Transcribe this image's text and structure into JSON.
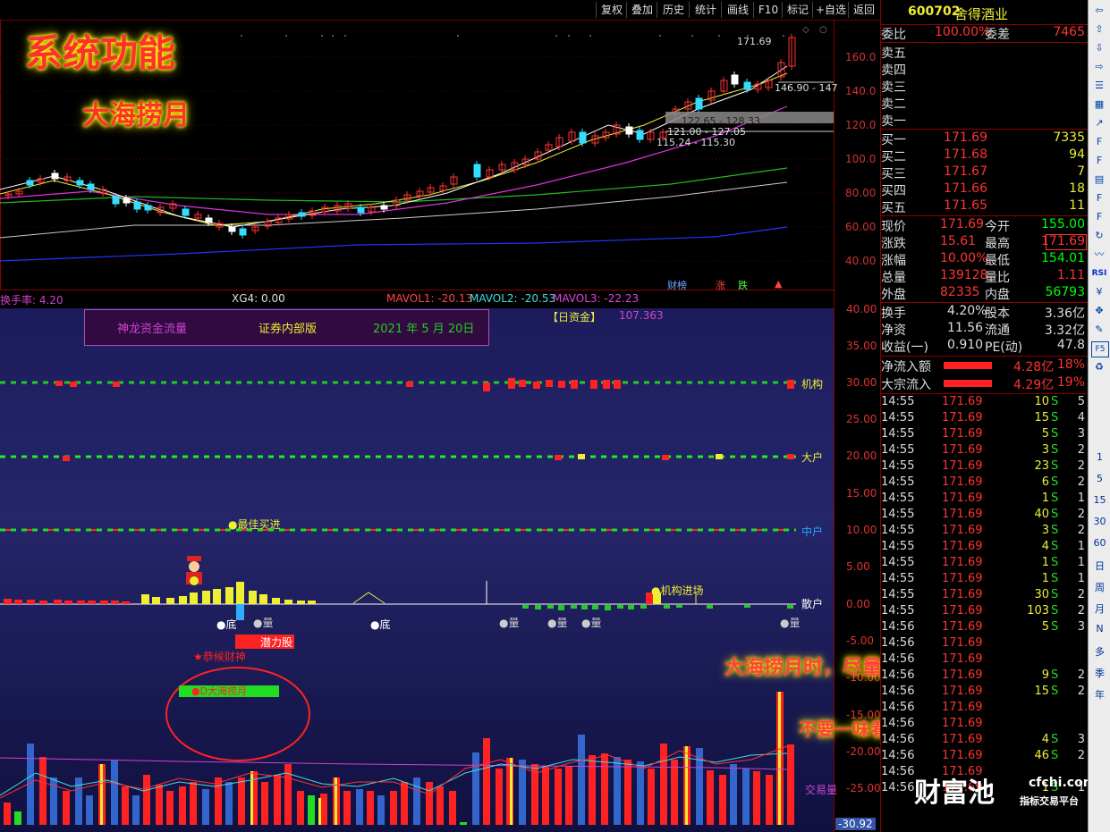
{
  "toolbar": {
    "buttons": [
      "复权",
      "叠加",
      "历史",
      "统计",
      "画线",
      "F10",
      "标记",
      "+自选",
      "返回"
    ]
  },
  "overlay": {
    "title": "系统功能",
    "subtitle": "大海捞月",
    "note1": "大海捞月时，尽量分析公司基本面",
    "note2": "不要一味看一个指标参数",
    "watermark_brand": "财富池",
    "watermark_url": "cfchi.com",
    "watermark_tag": "指标交易平台"
  },
  "kline": {
    "price_axis": [
      "160.0",
      "140.0",
      "120.0",
      "100.0",
      "80.00",
      "60.00",
      "40.00"
    ],
    "high_label": "171.69",
    "annotations": [
      "146.90 - 147",
      "122.65 - 128.33",
      "121.00 - 127.05",
      "115.24 - 115.30"
    ],
    "bottom_tags": [
      "财榜",
      "涨",
      "跌"
    ]
  },
  "indicator_bar": {
    "turnover": "换手率: 4.20",
    "xg4": "XG4: 0.00",
    "mavol1": "MAVOL1: -20.13",
    "mavol2": "MAVOL2: -20.53",
    "mavol3": "MAVOL3: -22.23"
  },
  "fund_panel": {
    "header_left": "神龙资金流量",
    "header_mid": "证券内部版",
    "header_date": "2021 年 5 月 20日",
    "day_fund_label": "【日资金】",
    "day_fund_value": "107.363",
    "axis": [
      "40.00",
      "35.00",
      "30.00",
      "25.00",
      "20.00",
      "15.00",
      "10.00",
      "5.00",
      "0.00",
      "-5.00",
      "-10.00",
      "-15.00",
      "-20.00",
      "-25.00",
      "-30.92"
    ],
    "line_labels": [
      "机构",
      "大户",
      "中户",
      "散户",
      "交易量"
    ],
    "best_buy": "●最佳买进",
    "inst_entry": "●机构进场",
    "bottom_marks": [
      "●底",
      "●量",
      "●底",
      "●量",
      "●量",
      "●量",
      "●量"
    ],
    "potential": "潜力股",
    "fortune": "★恭候财神",
    "dahai": "●D大海捞月"
  },
  "quote": {
    "code": "600702",
    "name": "舍得酒业",
    "wb_label": "委比",
    "wb_value": "100.00%",
    "wc_label": "委差",
    "wc_value": "7465",
    "sells": [
      {
        "label": "卖五",
        "price": "",
        "vol": ""
      },
      {
        "label": "卖四",
        "price": "",
        "vol": ""
      },
      {
        "label": "卖三",
        "price": "",
        "vol": ""
      },
      {
        "label": "卖二",
        "price": "",
        "vol": ""
      },
      {
        "label": "卖一",
        "price": "",
        "vol": ""
      }
    ],
    "buys": [
      {
        "label": "买一",
        "price": "171.69",
        "vol": "7335"
      },
      {
        "label": "买二",
        "price": "171.68",
        "vol": "94"
      },
      {
        "label": "买三",
        "price": "171.67",
        "vol": "7"
      },
      {
        "label": "买四",
        "price": "171.66",
        "vol": "18"
      },
      {
        "label": "买五",
        "price": "171.65",
        "vol": "11"
      }
    ],
    "stats": [
      {
        "l1": "现价",
        "v1": "171.69",
        "l2": "今开",
        "v2": "155.00",
        "c2": "#00ff00"
      },
      {
        "l1": "涨跌",
        "v1": "15.61",
        "l2": "最高",
        "v2": "171.69",
        "c2": "#ff3333"
      },
      {
        "l1": "涨幅",
        "v1": "10.00%",
        "l2": "最低",
        "v2": "154.01",
        "c2": "#00ff00"
      },
      {
        "l1": "总量",
        "v1": "139128",
        "l2": "量比",
        "v2": "1.11",
        "c2": "#ff3333"
      },
      {
        "l1": "外盘",
        "v1": "82335",
        "l2": "内盘",
        "v2": "56793",
        "c2": "#00ff00"
      }
    ],
    "stats2": [
      {
        "l1": "换手",
        "v1": "4.20%",
        "l2": "股本",
        "v2": "3.36亿"
      },
      {
        "l1": "净资",
        "v1": "11.56",
        "l2": "流通",
        "v2": "3.32亿"
      },
      {
        "l1": "收益(一)",
        "v1": "0.910",
        "l2": "PE(动)",
        "v2": "47.8"
      }
    ],
    "flow": [
      {
        "label": "净流入额",
        "amt": "4.28亿",
        "pct": "18%"
      },
      {
        "label": "大宗流入",
        "amt": "4.29亿",
        "pct": "19%"
      }
    ],
    "ticks": [
      {
        "t": "14:55",
        "p": "171.69",
        "v": "10",
        "s": "S",
        "n": "5"
      },
      {
        "t": "14:55",
        "p": "171.69",
        "v": "15",
        "s": "S",
        "n": "4"
      },
      {
        "t": "14:55",
        "p": "171.69",
        "v": "5",
        "s": "S",
        "n": "3"
      },
      {
        "t": "14:55",
        "p": "171.69",
        "v": "3",
        "s": "S",
        "n": "2"
      },
      {
        "t": "14:55",
        "p": "171.69",
        "v": "23",
        "s": "S",
        "n": "2"
      },
      {
        "t": "14:55",
        "p": "171.69",
        "v": "6",
        "s": "S",
        "n": "2"
      },
      {
        "t": "14:55",
        "p": "171.69",
        "v": "1",
        "s": "S",
        "n": "1"
      },
      {
        "t": "14:55",
        "p": "171.69",
        "v": "40",
        "s": "S",
        "n": "2"
      },
      {
        "t": "14:55",
        "p": "171.69",
        "v": "3",
        "s": "S",
        "n": "2"
      },
      {
        "t": "14:55",
        "p": "171.69",
        "v": "4",
        "s": "S",
        "n": "1"
      },
      {
        "t": "14:55",
        "p": "171.69",
        "v": "1",
        "s": "S",
        "n": "1"
      },
      {
        "t": "14:55",
        "p": "171.69",
        "v": "1",
        "s": "S",
        "n": "1"
      },
      {
        "t": "14:55",
        "p": "171.69",
        "v": "30",
        "s": "S",
        "n": "2"
      },
      {
        "t": "14:55",
        "p": "171.69",
        "v": "103",
        "s": "S",
        "n": "2"
      },
      {
        "t": "14:56",
        "p": "171.69",
        "v": "5",
        "s": "S",
        "n": "3"
      },
      {
        "t": "14:56",
        "p": "171.69",
        "v": "",
        "s": "",
        "n": ""
      },
      {
        "t": "14:56",
        "p": "171.69",
        "v": "",
        "s": "",
        "n": ""
      },
      {
        "t": "14:56",
        "p": "171.69",
        "v": "9",
        "s": "S",
        "n": "2"
      },
      {
        "t": "14:56",
        "p": "171.69",
        "v": "15",
        "s": "S",
        "n": "2"
      },
      {
        "t": "14:56",
        "p": "171.69",
        "v": "",
        "s": "",
        "n": ""
      },
      {
        "t": "14:56",
        "p": "171.69",
        "v": "",
        "s": "",
        "n": ""
      },
      {
        "t": "14:56",
        "p": "171.69",
        "v": "4",
        "s": "S",
        "n": "3"
      },
      {
        "t": "14:56",
        "p": "171.69",
        "v": "46",
        "s": "S",
        "n": "2"
      },
      {
        "t": "14:56",
        "p": "171.69",
        "v": "",
        "s": "",
        "n": ""
      },
      {
        "t": "14:56",
        "p": "171.69",
        "v": "1",
        "s": "S",
        "n": "1"
      }
    ]
  },
  "sidebar": {
    "periods": [
      "1",
      "5",
      "15",
      "30",
      "60",
      "日",
      "周",
      "月",
      "N",
      "多",
      "季",
      "年"
    ],
    "icons": [
      "back-icon",
      "up-icon",
      "down-icon",
      "export-icon",
      "list-icon",
      "grid-icon",
      "chart-icon",
      "f10-icon",
      "fi-icon",
      "doc-icon",
      "f12-icon",
      "f10b-icon",
      "refresh-icon",
      "wave-icon",
      "rsi-icon",
      "money-icon",
      "move-icon",
      "pen-icon",
      "f5-icon",
      "cycle-icon"
    ],
    "rsi": "RSI",
    "f5": "F5"
  }
}
